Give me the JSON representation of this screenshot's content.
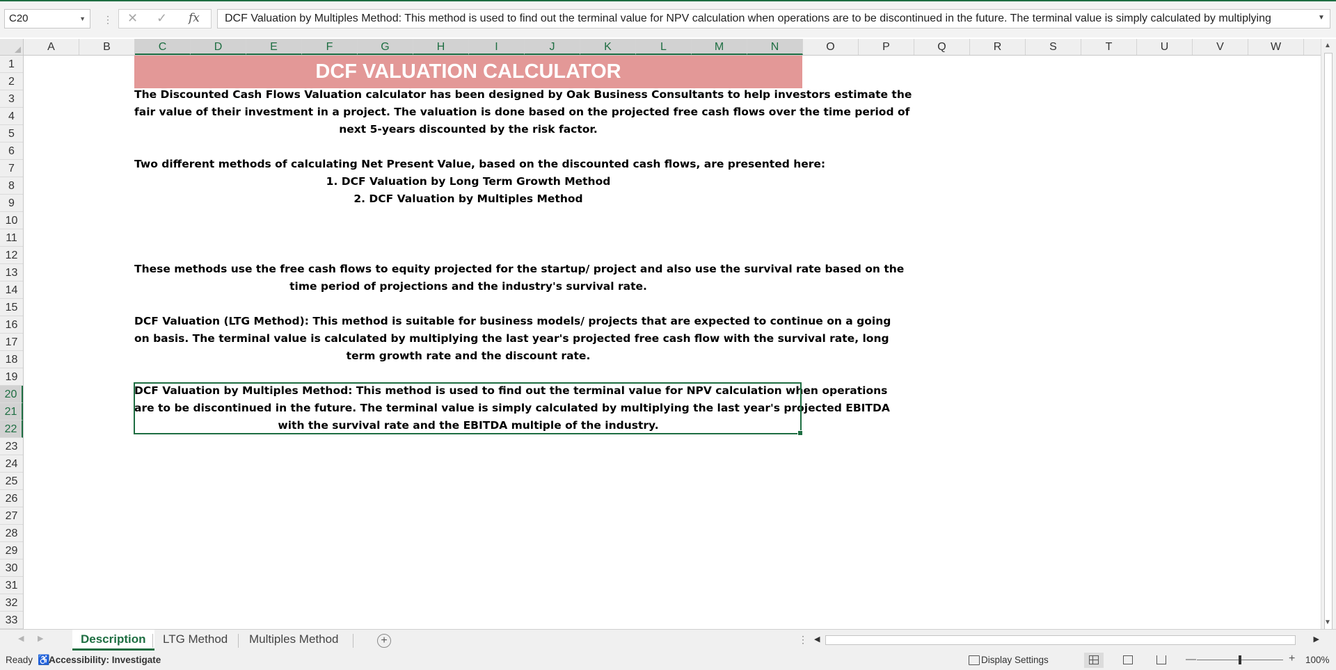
{
  "formula_bar": {
    "cell_ref": "C20",
    "fx_label": "fx",
    "content": "DCF Valuation by Multiples Method: This method is used to find out the terminal value for NPV calculation when operations are to be discontinued in the future. The terminal value is simply calculated  by multiplying"
  },
  "columns": [
    "A",
    "B",
    "C",
    "D",
    "E",
    "F",
    "G",
    "H",
    "I",
    "J",
    "K",
    "L",
    "M",
    "N",
    "O",
    "P",
    "Q",
    "R",
    "S",
    "T",
    "U",
    "V",
    "W"
  ],
  "rows": [
    "1",
    "2",
    "3",
    "4",
    "5",
    "6",
    "7",
    "8",
    "9",
    "10",
    "11",
    "12",
    "13",
    "14",
    "15",
    "16",
    "17",
    "18",
    "19",
    "20",
    "21",
    "22",
    "23",
    "24",
    "25",
    "26",
    "27",
    "28",
    "29",
    "30",
    "31",
    "32",
    "33"
  ],
  "sheet": {
    "title": "DCF VALUATION CALCULATOR",
    "para1": [
      "The Discounted Cash Flows Valuation calculator has been designed by Oak Business Consultants to help investors estimate the",
      "fair value of their investment in a project. The valuation is done based on the projected free cash flows over the time period of",
      "next 5-years discounted by the risk factor."
    ],
    "para2": [
      "Two different methods of calculating Net Present Value, based on the discounted cash flows, are presented here:",
      "1. DCF Valuation by Long Term Growth Method",
      "2. DCF Valuation by Multiples Method"
    ],
    "para3": [
      "These methods use the free cash flows to equity projected for the startup/ project and also use the survival rate based on the",
      "time period of projections and the industry's survival rate."
    ],
    "para4": [
      "DCF Valuation (LTG Method): This method is suitable for business models/ projects that are expected to continue on a going",
      "on basis. The terminal value is calculated by multiplying the last year's projected free cash flow with the survival rate, long",
      "term growth rate and the discount rate."
    ],
    "para5": [
      "DCF Valuation by Multiples Method: This method is used to find out the terminal value for NPV calculation when operations",
      "are to be discontinued in the future. The terminal value is simply calculated  by multiplying the last year's projected EBITDA",
      "with the survival rate and the EBITDA multiple of the industry."
    ]
  },
  "tabs": [
    "Description",
    "LTG Method",
    "Multiples Method"
  ],
  "status": {
    "ready": "Ready",
    "accessibility": "Accessibility: Investigate",
    "display_settings": "Display Settings",
    "zoom": "100%"
  },
  "colors": {
    "accent": "#1e6e42",
    "title_band": "#e39897"
  }
}
